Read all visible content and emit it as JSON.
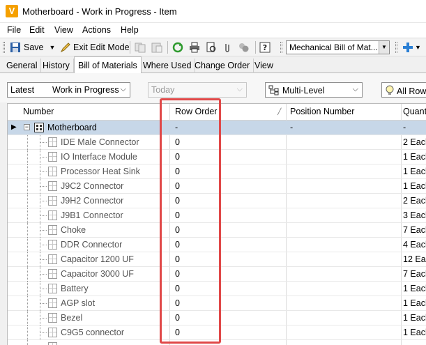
{
  "window": {
    "title": "Motherboard - Work in Progress - Item",
    "app_icon_letter": "V"
  },
  "menu": [
    "File",
    "Edit",
    "View",
    "Actions",
    "Help"
  ],
  "toolbar": {
    "save_label": "Save",
    "exit_edit_label": "Exit Edit Mode",
    "bom_combo_value": "Mechanical Bill of Mat..."
  },
  "tabs": [
    "General",
    "History",
    "Bill of Materials",
    "Where Used",
    "Change Order",
    "View"
  ],
  "active_tab": "Bill of Materials",
  "filters": {
    "version": "Latest",
    "state": "Work in Progress",
    "date": "Today",
    "structure": "Multi-Level",
    "rows": "All Row"
  },
  "grid": {
    "columns": [
      "Number",
      "Row Order",
      "Position Number",
      "Quant"
    ],
    "root": {
      "number": "Motherboard",
      "row_order": "-",
      "position": "-",
      "quantity": "-"
    },
    "rows": [
      {
        "number": "IDE Male Connector",
        "row_order": "0",
        "quantity": "2 Each"
      },
      {
        "number": "IO Interface Module",
        "row_order": "0",
        "quantity": "1 Each"
      },
      {
        "number": "Processor Heat Sink",
        "row_order": "0",
        "quantity": "1 Each"
      },
      {
        "number": "J9C2 Connector",
        "row_order": "0",
        "quantity": "1 Each"
      },
      {
        "number": "J9H2 Connector",
        "row_order": "0",
        "quantity": "2 Each"
      },
      {
        "number": "J9B1 Connector",
        "row_order": "0",
        "quantity": "3 Each"
      },
      {
        "number": "Choke",
        "row_order": "0",
        "quantity": "7 Each"
      },
      {
        "number": "DDR Connector",
        "row_order": "0",
        "quantity": "4 Each"
      },
      {
        "number": "Capacitor 1200 UF",
        "row_order": "0",
        "quantity": "12 Each"
      },
      {
        "number": "Capacitor 3000 UF",
        "row_order": "0",
        "quantity": "7 Each"
      },
      {
        "number": "Battery",
        "row_order": "0",
        "quantity": "1 Each"
      },
      {
        "number": "AGP slot",
        "row_order": "0",
        "quantity": "1 Each"
      },
      {
        "number": "Bezel",
        "row_order": "0",
        "quantity": "1 Each"
      },
      {
        "number": "C9G5 connector",
        "row_order": "0",
        "quantity": "1 Each"
      }
    ]
  },
  "colors": {
    "highlight": "#e04848",
    "selected_row": "#c7d7e8",
    "accent": "#f5a000"
  }
}
